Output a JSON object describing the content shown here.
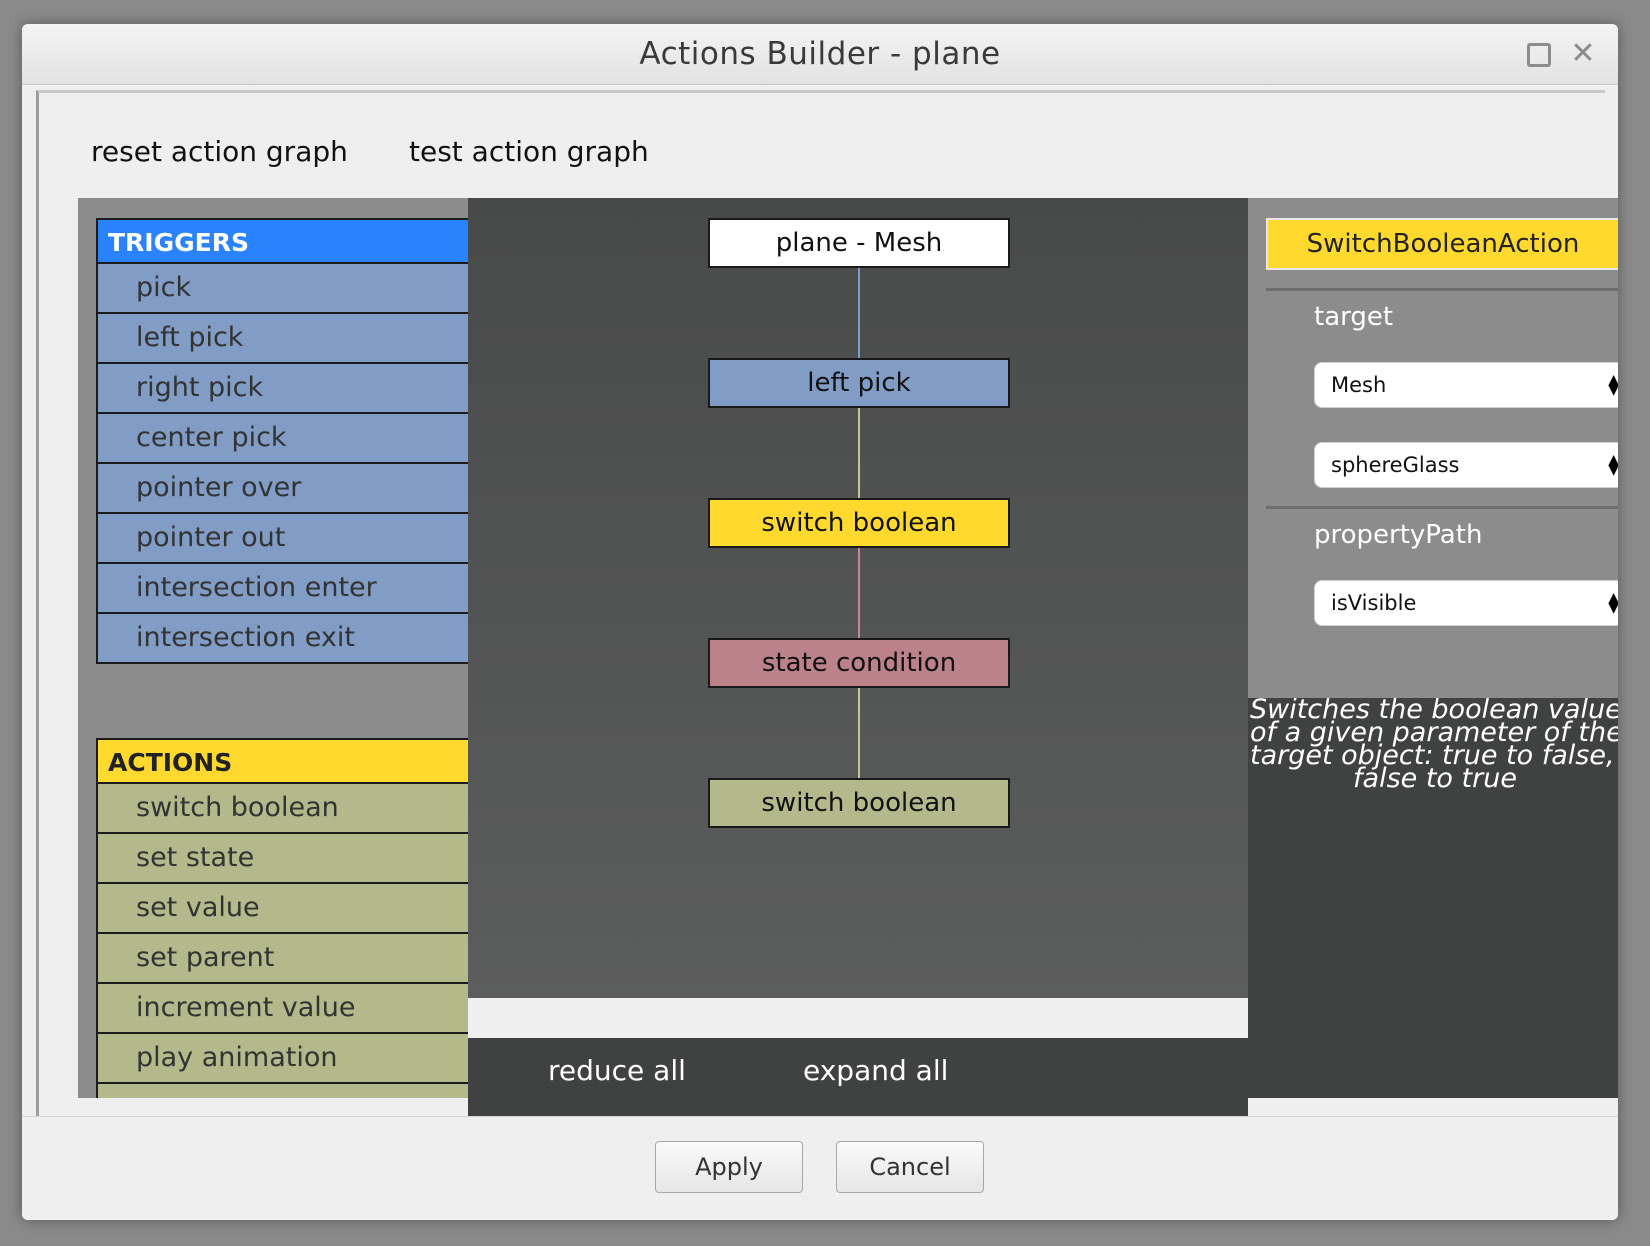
{
  "window": {
    "title": "Actions Builder - plane",
    "maximize_icon": "maximize-icon",
    "close_icon": "close-icon",
    "close_glyph": "✕"
  },
  "toolbar": {
    "reset_label": "reset action graph",
    "test_label": "test action graph"
  },
  "triggers": {
    "header": "TRIGGERS",
    "color": "#2a83fd",
    "items": [
      "pick",
      "left pick",
      "right pick",
      "center pick",
      "pointer over",
      "pointer out",
      "intersection enter",
      "intersection exit"
    ]
  },
  "actions": {
    "header": "ACTIONS",
    "color": "#ffd92e",
    "items": [
      "switch boolean",
      "set state",
      "set value",
      "set parent",
      "increment value",
      "play animation"
    ]
  },
  "graph": {
    "nodes": [
      {
        "label": "plane - Mesh",
        "kind": "root",
        "color": "#ffffff"
      },
      {
        "label": "left pick",
        "kind": "trigger",
        "color": "#819cc5"
      },
      {
        "label": "switch boolean",
        "kind": "action",
        "color": "#ffd92e"
      },
      {
        "label": "state condition",
        "kind": "condition",
        "color": "#bc8289"
      },
      {
        "label": "switch boolean",
        "kind": "action",
        "color": "#b3b98a"
      }
    ],
    "reduce_label": "reduce all",
    "expand_label": "expand all"
  },
  "inspector": {
    "title": "SwitchBooleanAction",
    "target_label": "target",
    "target_type": "Mesh",
    "target_name": "sphereGlass",
    "property_label": "propertyPath",
    "property_value": "isVisible",
    "select_arrows": "▲▼",
    "description_lines": [
      "Switches the boolean value",
      "of a given parameter of the",
      "target object: true to false, o",
      "false to true"
    ]
  },
  "footer": {
    "apply_label": "Apply",
    "cancel_label": "Cancel"
  }
}
